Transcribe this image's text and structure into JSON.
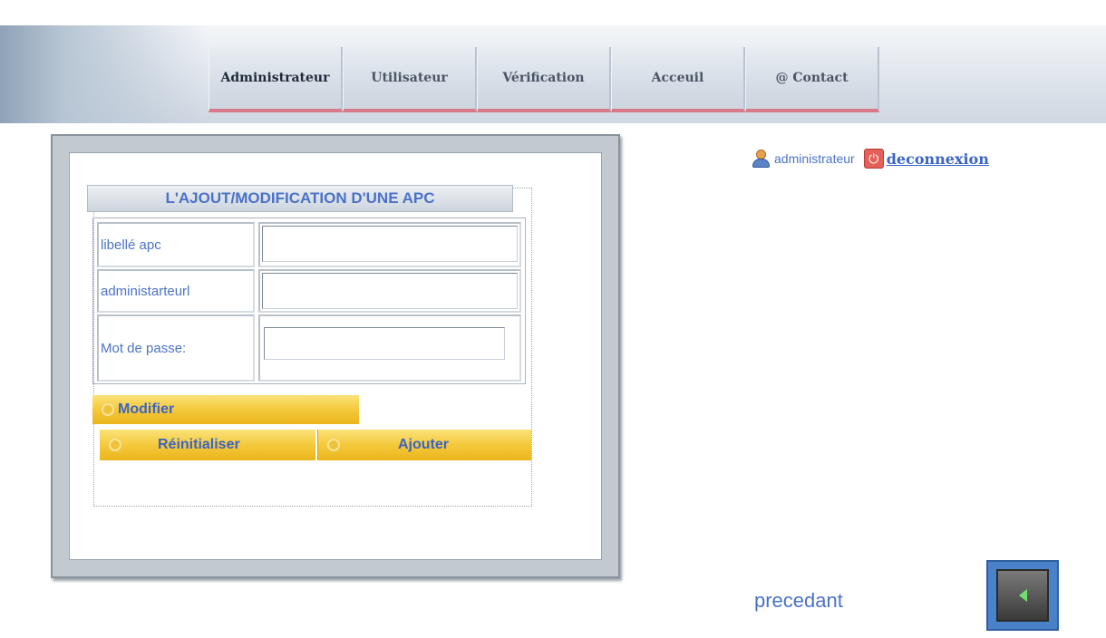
{
  "nav": {
    "tabs": [
      {
        "label": "Administrateur"
      },
      {
        "label": "Utilisateur"
      },
      {
        "label": "Vérification"
      },
      {
        "label": "Acceuil"
      },
      {
        "label": "@ Contact"
      }
    ]
  },
  "form": {
    "title": "L'AJOUT/MODIFICATION D'UNE APC",
    "fields": [
      {
        "label": "libellé apc",
        "value": ""
      },
      {
        "label": "administarteurl",
        "value": ""
      },
      {
        "label": "Mot de passe:",
        "value": ""
      }
    ],
    "buttons": {
      "modify": "Modifier",
      "reset": "Réinitialiser",
      "add": "Ajouter"
    }
  },
  "user": {
    "name": "administrateur",
    "logout": "deconnexion",
    "icon": "user-icon",
    "logout_icon": "power-icon"
  },
  "footer": {
    "previous_label": "precedant",
    "previous_icon": "arrow-left-icon"
  },
  "colors": {
    "accent_text": "#4b72c8",
    "button_yellow": "#f4c93b",
    "tab_underline": "#d97a8a"
  }
}
